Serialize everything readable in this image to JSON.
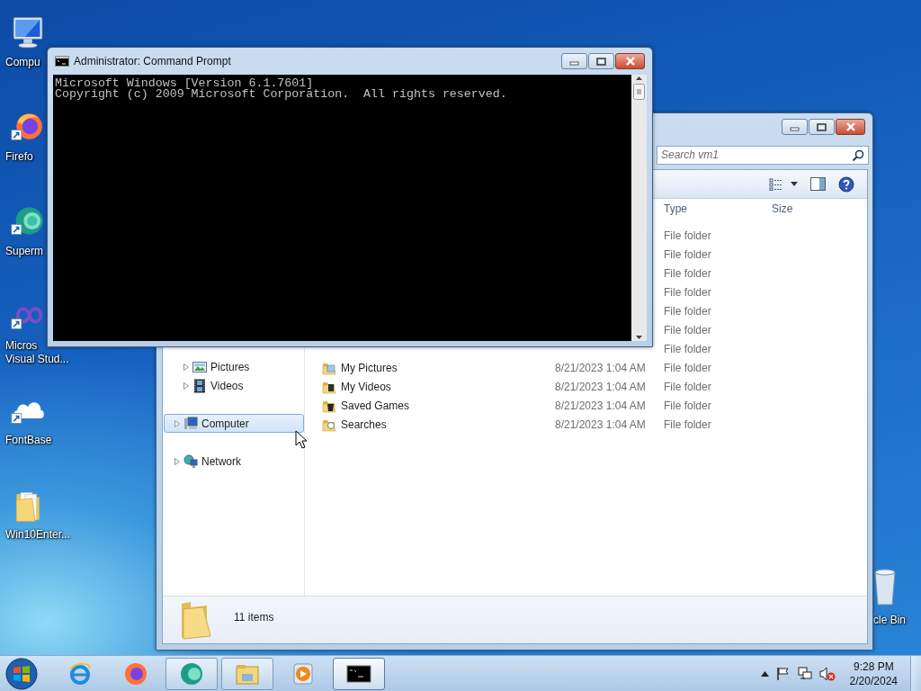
{
  "desktop_icons": [
    {
      "kind": "computer",
      "shortcut": false,
      "label_lines": [
        "Compu"
      ]
    },
    {
      "kind": "firefox",
      "shortcut": true,
      "label_lines": [
        "Firefo"
      ]
    },
    {
      "kind": "supermium",
      "shortcut": true,
      "label_lines": [
        "Superm"
      ]
    },
    {
      "kind": "visualstudio",
      "shortcut": true,
      "label_lines": [
        "Micros",
        "Visual Stud..."
      ]
    },
    {
      "kind": "fontbase",
      "shortcut": true,
      "label_lines": [
        "FontBase"
      ]
    },
    {
      "kind": "folder",
      "shortcut": false,
      "label_lines": [
        "Win10Enter..."
      ]
    }
  ],
  "recycle_bin": {
    "label": "cle Bin"
  },
  "command_prompt": {
    "title": "Administrator: Command Prompt",
    "lines": [
      "Microsoft Windows [Version 6.1.7601]",
      "Copyright (c) 2009 Microsoft Corporation.  All rights reserved."
    ]
  },
  "explorer": {
    "search": {
      "placeholder": "Search vm1"
    },
    "columns": [
      "Type",
      "Size"
    ],
    "navigation": [
      {
        "children": [
          {
            "label": "Pictures",
            "kind": "pictures",
            "selected": false
          },
          {
            "label": "Videos",
            "kind": "videos",
            "selected": false
          }
        ]
      },
      {
        "label": "Computer",
        "kind": "computer",
        "selected": true
      },
      {
        "label": "Network",
        "kind": "network",
        "selected": false
      }
    ],
    "rows": [
      {
        "type": "File folder"
      },
      {
        "type": "File folder"
      },
      {
        "type": "File folder"
      },
      {
        "type": "File folder"
      },
      {
        "type": "File folder"
      },
      {
        "type": "File folder"
      },
      {
        "type": "File folder"
      },
      {
        "name": "My Pictures",
        "kind": "pictures",
        "date": "8/21/2023 1:04 AM",
        "type": "File folder"
      },
      {
        "name": "My Videos",
        "kind": "videos",
        "date": "8/21/2023 1:04 AM",
        "type": "File folder"
      },
      {
        "name": "Saved Games",
        "kind": "games",
        "date": "8/21/2023 1:04 AM",
        "type": "File folder"
      },
      {
        "name": "Searches",
        "kind": "searches",
        "date": "8/21/2023 1:04 AM",
        "type": "File folder"
      }
    ],
    "status": "11 items"
  },
  "taskbar": {
    "buttons": [
      {
        "kind": "ie",
        "open": false,
        "active": false
      },
      {
        "kind": "firefox",
        "open": false,
        "active": false
      },
      {
        "kind": "supermium",
        "open": true,
        "active": false
      },
      {
        "kind": "explorer",
        "open": true,
        "active": false
      },
      {
        "kind": "mediaplayer",
        "open": false,
        "active": false
      },
      {
        "kind": "cmd",
        "open": true,
        "active": true
      }
    ],
    "clock": {
      "time": "9:28 PM",
      "date": "2/20/2024"
    }
  }
}
